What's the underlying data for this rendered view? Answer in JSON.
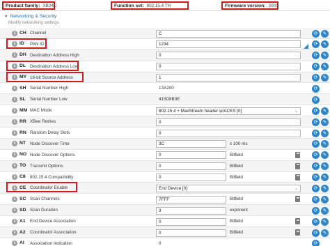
{
  "topbar": {
    "product_family_label": "Product family:",
    "product_family_value": "XB24C",
    "function_set_label": "Function set:",
    "function_set_value": "802.15.4 TH",
    "firmware_label": "Firmware version:",
    "firmware_value": "2001"
  },
  "section": {
    "arrow": "▼",
    "title": "Networking & Security",
    "subtitle": "Modify networking settings"
  },
  "icons": {
    "info": "info-icon",
    "read": "refresh-icon",
    "write": "pencil-icon",
    "calc": "calculator-icon"
  },
  "colors": {
    "accent": "#2f86c6",
    "highlight": "#d11a1a",
    "section_title": "#1d6fb8"
  },
  "rows": [
    {
      "code": "CH",
      "name": "Channel",
      "kind": "input",
      "value": "C"
    },
    {
      "code": "ID",
      "name": "PAN ID",
      "kind": "input",
      "value": "1234",
      "modified": true
    },
    {
      "code": "DH",
      "name": "Destination Address High",
      "kind": "input",
      "value": "0"
    },
    {
      "code": "DL",
      "name": "Destination Address Low",
      "kind": "input",
      "value": "0"
    },
    {
      "code": "MY",
      "name": "16-bit Source Address",
      "kind": "input",
      "value": "1"
    },
    {
      "code": "SH",
      "name": "Serial Number High",
      "kind": "text",
      "value": "13A200"
    },
    {
      "code": "SL",
      "name": "Serial Number Low",
      "kind": "text",
      "value": "415D8B0E"
    },
    {
      "code": "MM",
      "name": "MAC Mode",
      "kind": "select",
      "value": "802.15.4 + MaxStream header w/ACKS [0]"
    },
    {
      "code": "RR",
      "name": "XBee Retries",
      "kind": "input-wide",
      "value": "0"
    },
    {
      "code": "RN",
      "name": "Random Delay Slots",
      "kind": "input-wide",
      "value": "0"
    },
    {
      "code": "NT",
      "name": "Node Discover Time",
      "kind": "input-suffix",
      "value": "3C",
      "suffix": "x 100 ms"
    },
    {
      "code": "NO",
      "name": "Node Discover Options",
      "kind": "input-suffix",
      "value": "0",
      "suffix": "Bitfield"
    },
    {
      "code": "TO",
      "name": "Transmit Options",
      "kind": "input-suffix",
      "value": "0",
      "suffix": "Bitfield"
    },
    {
      "code": "C8",
      "name": "802.15.4 Compatibility",
      "kind": "input-suffix",
      "value": "0",
      "suffix": "Bitfield"
    },
    {
      "code": "CE",
      "name": "Coordinator Enable",
      "kind": "select",
      "value": "End Device [0]"
    },
    {
      "code": "SC",
      "name": "Scan Channels",
      "kind": "input-suffix",
      "value": "7FFF",
      "suffix": "Bitfield"
    },
    {
      "code": "SD",
      "name": "Scan Duration",
      "kind": "input-suffix",
      "value": "3",
      "suffix": "exponent"
    },
    {
      "code": "A1",
      "name": "End Device Association",
      "kind": "input-suffix",
      "value": "0",
      "suffix": "Bitfield"
    },
    {
      "code": "A2",
      "name": "Coordinator Association",
      "kind": "input-suffix",
      "value": "0",
      "suffix": "Bitfield"
    },
    {
      "code": "AI",
      "name": "Association Indication",
      "kind": "text",
      "value": "0"
    }
  ]
}
